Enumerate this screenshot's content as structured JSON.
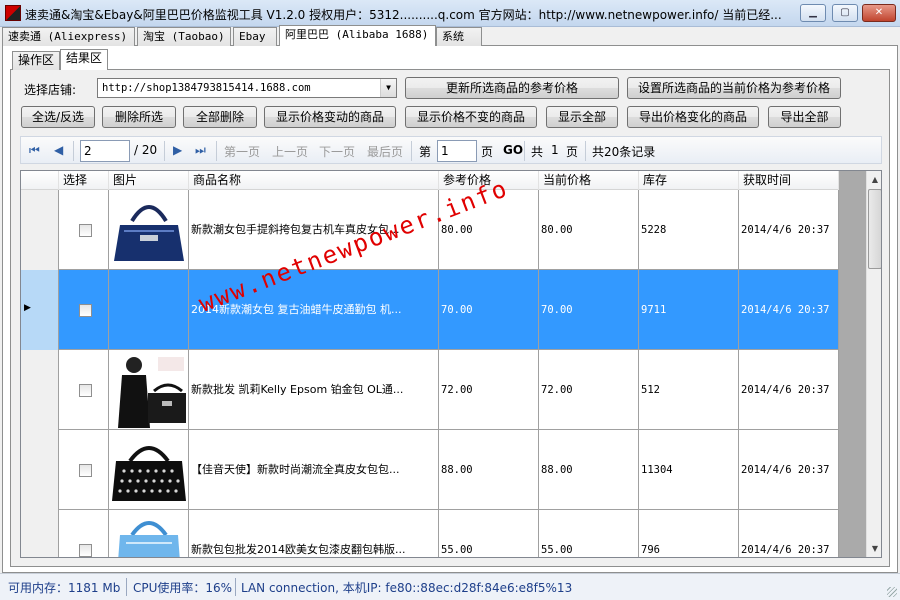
{
  "window": {
    "title": "速卖通&淘宝&Ebay&阿里巴巴价格监视工具 V1.2.0 授权用户：5312..........q.com 官方网站：http://www.netnewpower.info/ 当前已经..."
  },
  "main_tabs": [
    {
      "label": "速卖通 (Aliexpress)"
    },
    {
      "label": "淘宝 (Taobao)"
    },
    {
      "label": "Ebay"
    },
    {
      "label": "阿里巴巴 (Alibaba 1688)"
    },
    {
      "label": "系统"
    }
  ],
  "sub_tabs": [
    {
      "label": "操作区"
    },
    {
      "label": "结果区"
    }
  ],
  "shop": {
    "label": "选择店铺:",
    "value": "http://shop1384793815414.1688.com"
  },
  "buttons": {
    "update_ref": "更新所选商品的参考价格",
    "set_ref": "设置所选商品的当前价格为参考价格",
    "select_all": "全选/反选",
    "delete_selected": "删除所选",
    "delete_all": "全部删除",
    "show_changed": "显示价格变动的商品",
    "show_unchanged": "显示价格不变的商品",
    "show_all": "显示全部",
    "export_changed": "导出价格变化的商品",
    "export_all": "导出全部"
  },
  "navigator": {
    "page_value": "2",
    "page_total": "/ 20",
    "first": "第一页",
    "prev": "上一页",
    "next": "下一页",
    "last": "最后页",
    "goto_prefix": "第",
    "goto_value": "1",
    "goto_suffix": "页",
    "go": "GO",
    "total_pages_prefix": "共",
    "total_pages_value": "1",
    "total_pages_suffix": "页",
    "total_records": "共20条记录"
  },
  "grid": {
    "columns": [
      "选择",
      "图片",
      "商品名称",
      "参考价格",
      "当前价格",
      "库存",
      "获取时间"
    ],
    "selected_row": 1,
    "rows": [
      {
        "name": "新款潮女包手提斜挎包复古机车真皮女包...",
        "ref_price": "80.00",
        "cur_price": "80.00",
        "stock": "5228",
        "time": "2014/4/6 20:37",
        "image": "navy-leather-handbag"
      },
      {
        "name": "2014新款潮女包 复古油蜡牛皮通勤包 机...",
        "ref_price": "70.00",
        "cur_price": "70.00",
        "stock": "9711",
        "time": "2014/4/6 20:37",
        "image": "none"
      },
      {
        "name": "新款批发 凯莉Kelly Epsom 铂金包 OL通...",
        "ref_price": "72.00",
        "cur_price": "72.00",
        "stock": "512",
        "time": "2014/4/6 20:37",
        "image": "black-kelly-bag-with-model"
      },
      {
        "name": "【佳音天使】新款时尚潮流全真皮女包包...",
        "ref_price": "88.00",
        "cur_price": "88.00",
        "stock": "11304",
        "time": "2014/4/6 20:37",
        "image": "black-studded-handbag"
      },
      {
        "name": "新款包包批发2014欧美女包漆皮翻包韩版...",
        "ref_price": "55.00",
        "cur_price": "55.00",
        "stock": "796",
        "time": "2014/4/6 20:37",
        "image": "light-blue-patent-bag"
      }
    ]
  },
  "watermark": "www.netnewpower.info",
  "status": {
    "memory": "可用内存：1181 Mb",
    "cpu": "CPU使用率：16%",
    "network": "LAN connection, 本机IP: fe80::88ec:d28f:84e6:e8f5%13"
  },
  "colors": {
    "selection": "#3399ff",
    "watermark": "#e00000",
    "status_text": "#1e3f8a"
  }
}
